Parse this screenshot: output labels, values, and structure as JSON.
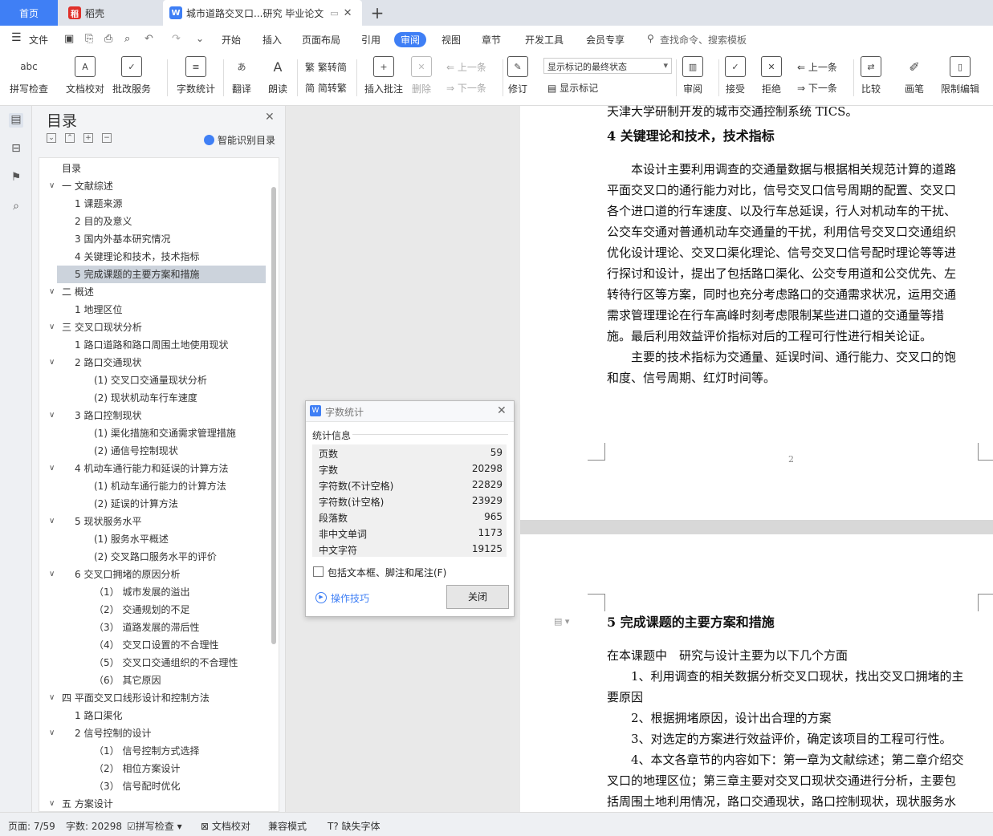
{
  "tabs": {
    "home": "首页",
    "daoke": "稻壳",
    "document": "城市道路交叉口...研究 毕业论文",
    "add": "+"
  },
  "menu": {
    "file": "文件",
    "items": [
      "开始",
      "插入",
      "页面布局",
      "引用",
      "审阅",
      "视图",
      "章节",
      "开发工具",
      "会员专享"
    ],
    "search_placeholder": "查找命令、搜索模板"
  },
  "ribbon": {
    "spellcheck": "拼写检查",
    "proofread": "文档校对",
    "annotate_service": "批改服务",
    "word_count": "字数统计",
    "translate": "翻译",
    "read_aloud": "朗读",
    "to_traditional": "繁转简",
    "to_simplified": "简转繁",
    "insert_comment": "插入批注",
    "delete": "删除",
    "prev_comment": "上一条",
    "next_comment": "下一条",
    "revise": "修订",
    "track_mode": "显示标记的最终状态",
    "show_markup": "显示标记",
    "review": "审阅",
    "accept": "接受",
    "reject": "拒绝",
    "prev": "上一条",
    "next": "下一条",
    "compare": "比较",
    "pen": "画笔",
    "restrict_edit": "限制编辑"
  },
  "toc": {
    "title": "目录",
    "smart_label": "智能识别目录",
    "items": [
      {
        "label": "目录",
        "level": 0,
        "twisty": ""
      },
      {
        "label": "一 文献综述",
        "level": 0,
        "twisty": "∨"
      },
      {
        "label": "1 课题来源",
        "level": 1,
        "twisty": ""
      },
      {
        "label": "2 目的及意义",
        "level": 1,
        "twisty": ""
      },
      {
        "label": "3 国内外基本研究情况",
        "level": 1,
        "twisty": ""
      },
      {
        "label": "4 关键理论和技术，技术指标",
        "level": 1,
        "twisty": ""
      },
      {
        "label": "5 完成课题的主要方案和措施",
        "level": 1,
        "twisty": "",
        "selected": true
      },
      {
        "label": "二 概述",
        "level": 0,
        "twisty": "∨"
      },
      {
        "label": "1 地理区位",
        "level": 1,
        "twisty": ""
      },
      {
        "label": "三 交叉口现状分析",
        "level": 0,
        "twisty": "∨"
      },
      {
        "label": "1 路口道路和路口周围土地使用现状",
        "level": 1,
        "twisty": ""
      },
      {
        "label": "2 路口交通现状",
        "level": 1,
        "twisty": "∨"
      },
      {
        "label": "(1)  交叉口交通量现状分析",
        "level": 2,
        "twisty": ""
      },
      {
        "label": "(2)  现状机动车行车速度",
        "level": 2,
        "twisty": ""
      },
      {
        "label": "3 路口控制现状",
        "level": 1,
        "twisty": "∨"
      },
      {
        "label": "(1)  渠化措施和交通需求管理措施",
        "level": 2,
        "twisty": ""
      },
      {
        "label": "(2)  通信号控制现状",
        "level": 2,
        "twisty": ""
      },
      {
        "label": "4 机动车通行能力和延误的计算方法",
        "level": 1,
        "twisty": "∨"
      },
      {
        "label": "(1)  机动车通行能力的计算方法",
        "level": 2,
        "twisty": ""
      },
      {
        "label": "(2)  延误的计算方法",
        "level": 2,
        "twisty": ""
      },
      {
        "label": "5 现状服务水平",
        "level": 1,
        "twisty": "∨"
      },
      {
        "label": "(1)  服务水平概述",
        "level": 2,
        "twisty": ""
      },
      {
        "label": "(2)  交叉路口服务水平的评价",
        "level": 2,
        "twisty": ""
      },
      {
        "label": "6 交叉口拥堵的原因分析",
        "level": 1,
        "twisty": "∨"
      },
      {
        "label": "（1）  城市发展的溢出",
        "level": 2,
        "twisty": ""
      },
      {
        "label": "（2）  交通规划的不足",
        "level": 2,
        "twisty": ""
      },
      {
        "label": "（3）  道路发展的滞后性",
        "level": 2,
        "twisty": ""
      },
      {
        "label": "（4）  交叉口设置的不合理性",
        "level": 2,
        "twisty": ""
      },
      {
        "label": "（5）  交叉口交通组织的不合理性",
        "level": 2,
        "twisty": ""
      },
      {
        "label": "（6）  其它原因",
        "level": 2,
        "twisty": ""
      },
      {
        "label": "四 平面交叉口线形设计和控制方法",
        "level": 0,
        "twisty": "∨"
      },
      {
        "label": "1 路口渠化",
        "level": 1,
        "twisty": ""
      },
      {
        "label": "2 信号控制的设计",
        "level": 1,
        "twisty": "∨"
      },
      {
        "label": "（1）  信号控制方式选择",
        "level": 2,
        "twisty": ""
      },
      {
        "label": "（2）  相位方案设计",
        "level": 2,
        "twisty": ""
      },
      {
        "label": "（3）  信号配时优化",
        "level": 2,
        "twisty": ""
      },
      {
        "label": "五 方案设计",
        "level": 0,
        "twisty": "∨"
      }
    ]
  },
  "page1": {
    "lines": [
      "天津大学研制开发的城市交通控制系统 TICS。",
      "4 关键理论和技术，技术指标",
      "　　本设计主要利用调查的交通量数据与根据相关规范计算的道路",
      "平面交叉口的通行能力对比，信号交叉口信号周期的配置、交叉口",
      "各个进口道的行车速度、以及行车总延误，行人对机动车的干扰、",
      "公交车交通对普通机动车交通量的干扰，利用信号交叉口交通组织",
      "优化设计理论、交叉口渠化理论、信号交叉口信号配时理论等等进",
      "行探讨和设计，提出了包括路口渠化、公交专用道和公交优先、左",
      "转待行区等方案，同时也充分考虑路口的交通需求状况，运用交通",
      "需求管理理论在行车高峰时刻考虑限制某些进口道的交通量等措",
      "施。最后利用效益评价指标对后的工程可行性进行相关论证。",
      "　　主要的技术指标为交通量、延误时间、通行能力、交叉口的饱",
      "和度、信号周期、红灯时间等。"
    ],
    "page_number": "2"
  },
  "page2": {
    "lines": [
      "5 完成课题的主要方案和措施",
      "在本课题中　研究与设计主要为以下几个方面",
      "　　1、利用调查的相关数据分析交叉口现状，找出交叉口拥堵的主",
      "要原因",
      "　　2、根据拥堵原因，设计出合理的方案",
      "　　3、对选定的方案进行效益评价，确定该项目的工程可行性。",
      "　　4、本文各章节的内容如下：第一章为文献综述；第二章介绍交",
      "叉口的地理区位；第三章主要对交叉口现状交通进行分析，主要包",
      "括周围土地利用情况，路口交通现状，路口控制现状，现状服务水"
    ]
  },
  "word_count_dialog": {
    "title": "字数统计",
    "section": "统计信息",
    "rows": [
      {
        "key": "页数",
        "value": "59"
      },
      {
        "key": "字数",
        "value": "20298"
      },
      {
        "key": "字符数(不计空格)",
        "value": "22829"
      },
      {
        "key": "字符数(计空格)",
        "value": "23929"
      },
      {
        "key": "段落数",
        "value": "965"
      },
      {
        "key": "非中文单词",
        "value": "1173"
      },
      {
        "key": "中文字符",
        "value": "19125"
      }
    ],
    "checkbox_label": "包括文本框、脚注和尾注(F)",
    "tips_link": "操作技巧",
    "close_button": "关闭"
  },
  "status": {
    "page": "页面: 7/59",
    "words": "字数: 20298",
    "spellcheck": "拼写检查",
    "proofread": "文档校对",
    "compat_mode": "兼容模式",
    "missing_fonts": "缺失字体"
  },
  "colors": {
    "accent": "#3f7ff5",
    "selected_toc": "#ccd3dc"
  }
}
